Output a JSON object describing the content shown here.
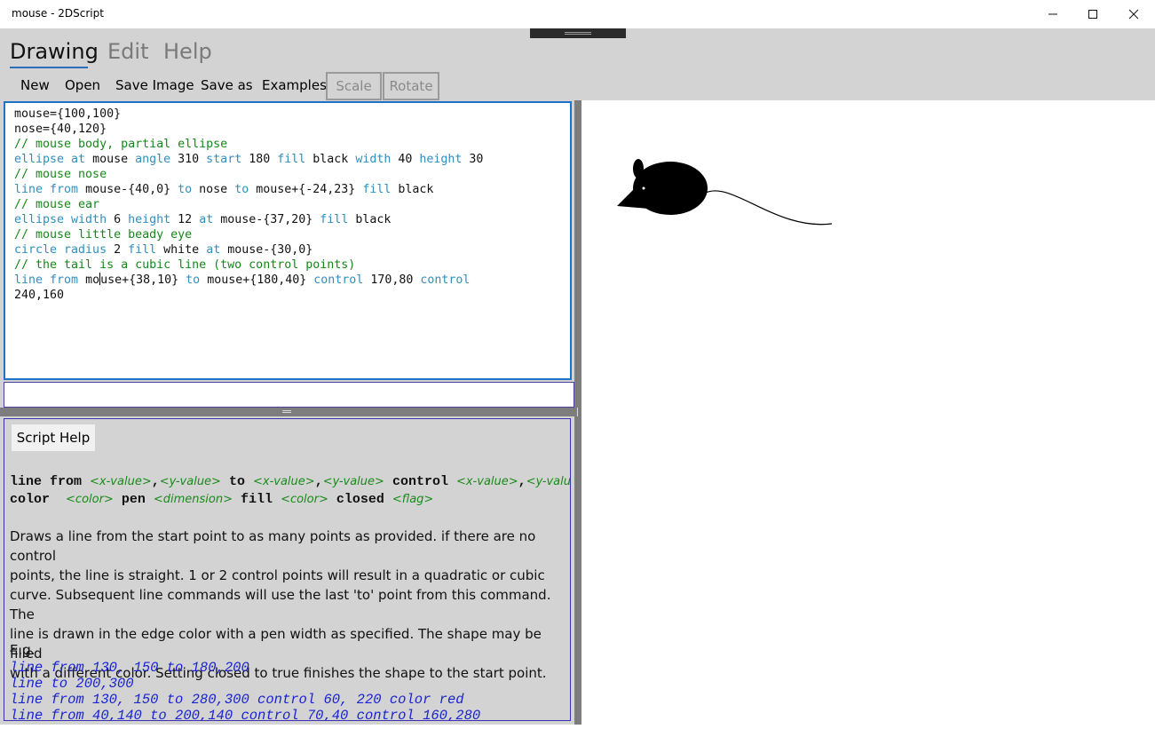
{
  "window": {
    "title": "mouse - 2DScript"
  },
  "tabs": [
    {
      "label": "Drawing",
      "active": true
    },
    {
      "label": "Edit",
      "active": false
    },
    {
      "label": "Help",
      "active": false
    }
  ],
  "toolbar": {
    "new": "New",
    "open": "Open",
    "save_image": "Save Image",
    "save_as": "Save as",
    "examples": "Examples",
    "scale": "Scale",
    "rotate": "Rotate"
  },
  "editor": {
    "lines": [
      "mouse={100,100}",
      "nose={40,120}",
      "// mouse body, partial ellipse",
      "ellipse at mouse angle 310 start 180 fill black width 40 height 30",
      "// mouse nose",
      "line from mouse-{40,0} to nose to mouse+{-24,23} fill black",
      "// mouse ear",
      "ellipse width 6 height 12 at mouse-{37,20} fill black",
      "// mouse little beady eye",
      "circle radius 2 fill white at mouse-{30,0}",
      "// the tail is a cubic line (two control points)",
      "line from mouse+{38,10} to mouse+{180,40} control 170,80 control",
      "240,160"
    ]
  },
  "command_input": {
    "value": ""
  },
  "help": {
    "button_label": "Script Help",
    "syntax": {
      "line1": {
        "kw1": "line from",
        "a1": "<x-value>",
        "s1": ",",
        "a2": "<y-value>",
        "kw2": "to",
        "a3": "<x-value>",
        "s2": ",",
        "a4": "<y-value>",
        "kw3": "control",
        "a5": "<x-value>",
        "s3": ",",
        "a6": "<y-value>"
      },
      "line2": {
        "kw1": "color",
        "a1": "<color>",
        "kw2": "pen",
        "a2": "<dimension>",
        "kw3": "fill",
        "a3": "<color>",
        "kw4": "closed",
        "a4": "<flag>"
      }
    },
    "description": [
      "Draws a line from the start point to as many points as provided.  if there are no control",
      "points, the line is straight. 1 or 2 control points will result  in a quadratic or cubic",
      "curve. Subsequent line commands will use the last 'to' point from this command. The",
      "line is drawn in the edge color with a pen width as specified. The shape may be filled",
      "with a different color. Setting closed to true finishes the shape to the start point."
    ],
    "eg_label": "E.g.",
    "examples": [
      "line from 130, 150 to 180,200",
      "line to 200,300",
      "line from 130, 150 to 280,300 control 60, 220 color red",
      "line from 40,140 to 200,140 control 70,40 control 160,280"
    ]
  },
  "colors": {
    "accent": "#1f73c7",
    "keyword": "#2f8fbf",
    "comment": "#16871a",
    "example": "#1a24d0",
    "panel": "#d3d3d3"
  }
}
